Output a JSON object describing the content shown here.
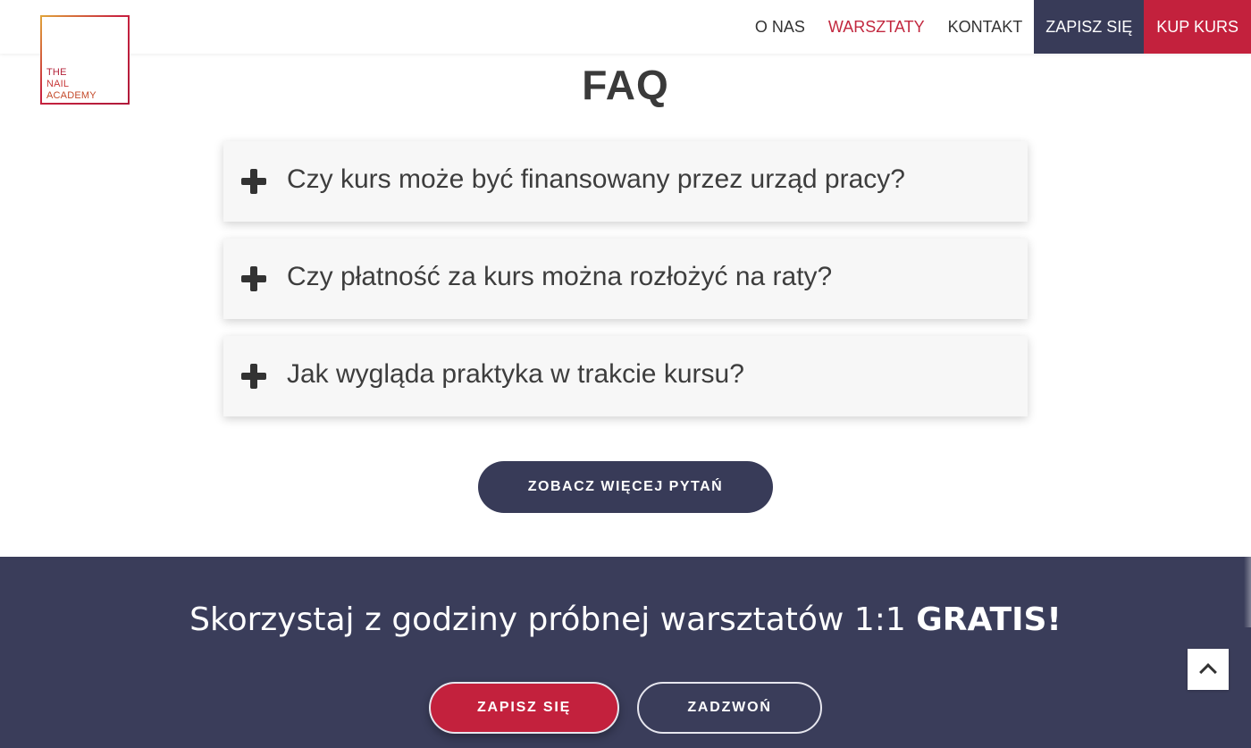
{
  "brand": {
    "logo_lines": [
      "THE",
      "NAIL",
      "ACADEMY"
    ]
  },
  "nav": {
    "items": [
      {
        "label": "O NAS"
      },
      {
        "label": "WARSZTATY"
      },
      {
        "label": "KONTAKT"
      },
      {
        "label": "ZAPISZ SIĘ"
      },
      {
        "label": "KUP KURS"
      }
    ],
    "active": "WARSZTATY"
  },
  "faq": {
    "title": "FAQ",
    "questions": [
      {
        "text": "Czy kurs może być finansowany przez urząd pracy?"
      },
      {
        "text": "Czy płatność za kurs można rozłożyć na raty?"
      },
      {
        "text": "Jak wygląda praktyka w trakcie kursu?"
      }
    ],
    "more_button": "ZOBACZ WIĘCEJ PYTAŃ"
  },
  "cta": {
    "text": "Skorzystaj z godziny próbnej warsztatów 1:1 ",
    "emphasis": "GRATIS!",
    "signup_button": "ZAPISZ SIĘ",
    "call_button": "ZADZWOŃ"
  },
  "colors": {
    "accent_red": "#c3213d",
    "navy": "#383b58",
    "footer_bg": "#3a3d5a",
    "faq_item_bg": "#f7f7f7"
  },
  "icons": [
    "plus-icon",
    "chevron-up-icon"
  ]
}
